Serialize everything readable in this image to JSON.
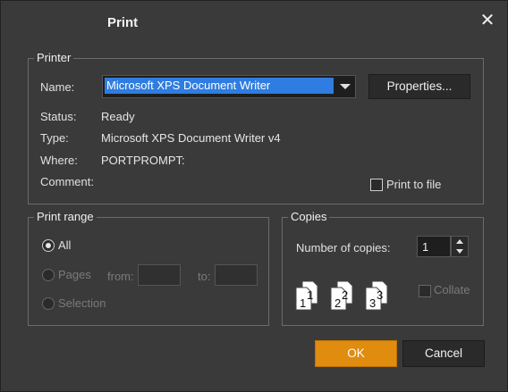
{
  "dialog": {
    "title": "Print",
    "close_glyph": "✕"
  },
  "printer": {
    "legend": "Printer",
    "name_label": "Name:",
    "name_value": "Microsoft XPS Document Writer",
    "properties_label": "Properties...",
    "status_label": "Status:",
    "status_value": "Ready",
    "type_label": "Type:",
    "type_value": "Microsoft XPS Document Writer v4",
    "where_label": "Where:",
    "where_value": "PORTPROMPT:",
    "comment_label": "Comment:",
    "comment_value": "",
    "print_to_file_label": "Print to file",
    "print_to_file_checked": false
  },
  "range": {
    "legend": "Print range",
    "all_label": "All",
    "pages_label": "Pages",
    "from_label": "from:",
    "to_label": "to:",
    "selection_label": "Selection",
    "selected": "All"
  },
  "copies": {
    "legend": "Copies",
    "number_label": "Number of copies:",
    "number_value": "1",
    "collate_label": "Collate",
    "collate_checked": false,
    "page_digits": [
      "1",
      "1",
      "2",
      "2",
      "3",
      "3"
    ]
  },
  "buttons": {
    "ok": "OK",
    "cancel": "Cancel"
  },
  "colors": {
    "accent": "#e08c0f",
    "selection": "#2f7de0",
    "background": "#3a3a3a"
  },
  "icons": {
    "close": "close-icon",
    "dropdown": "chevron-down-icon"
  }
}
